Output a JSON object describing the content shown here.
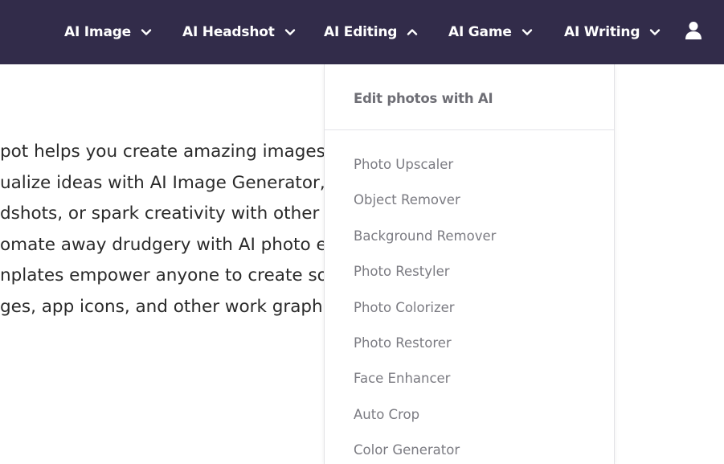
{
  "nav": {
    "items": [
      {
        "label": "AI Image",
        "chevron": "down"
      },
      {
        "label": "AI Headshot",
        "chevron": "down"
      },
      {
        "label": "AI Editing",
        "chevron": "up"
      },
      {
        "label": "AI Game",
        "chevron": "down"
      },
      {
        "label": "AI Writing",
        "chevron": "down"
      }
    ],
    "user_icon": "user-icon",
    "background_color": "#322c4a"
  },
  "content": {
    "lines": [
      "pot helps you create amazing images, gra",
      "ualize ideas with AI Image Generator, reim",
      "dshots, or spark creativity with other pro",
      "omate away drudgery with AI photo editi",
      "nplates empower anyone to create social",
      "ges, app icons, and other work graphics."
    ]
  },
  "dropdown": {
    "header": "Edit photos with AI",
    "items": [
      "Photo Upscaler",
      "Object Remover",
      "Background Remover",
      "Photo Restyler",
      "Photo Colorizer",
      "Photo Restorer",
      "Face Enhancer",
      "Auto Crop",
      "Color Generator"
    ]
  }
}
